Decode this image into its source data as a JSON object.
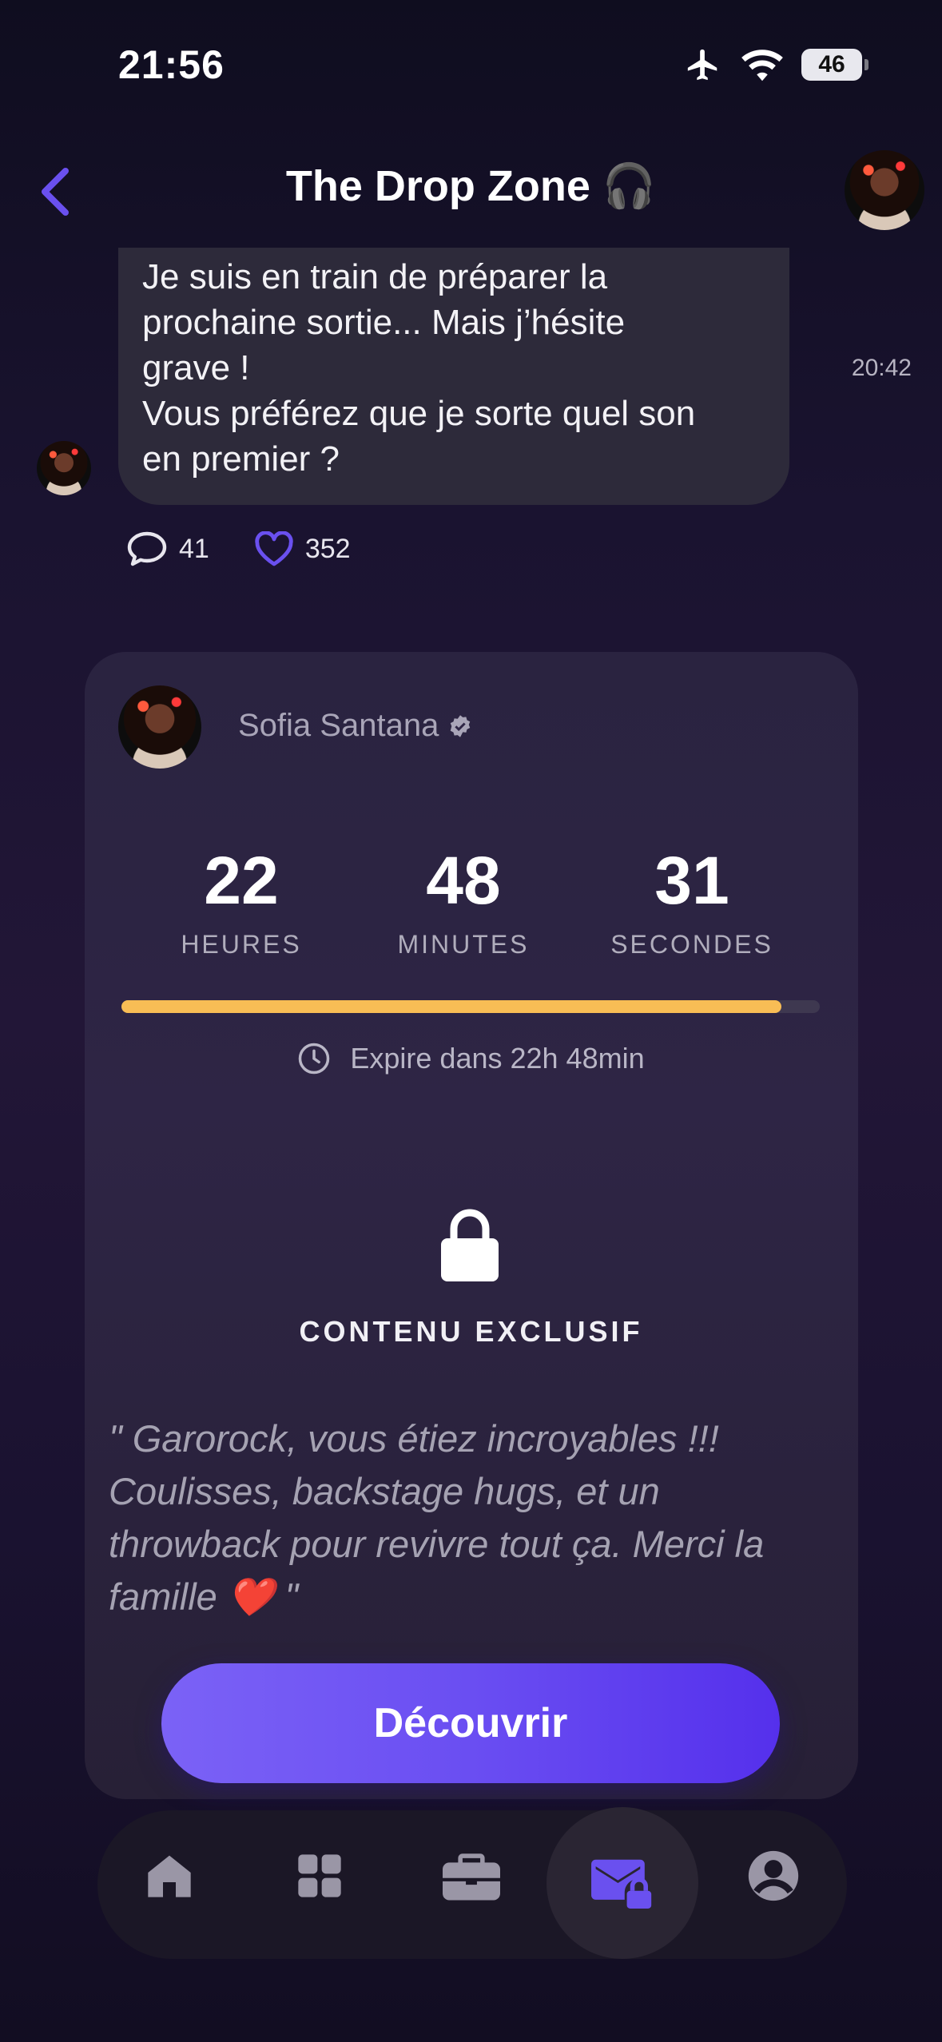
{
  "status_bar": {
    "time": "21:56",
    "battery": "46"
  },
  "header": {
    "title": "The Drop Zone 🎧"
  },
  "message": {
    "lines": [
      "Je suis en train de préparer la",
      "prochaine sortie... Mais j’hésite",
      "grave !",
      "Vous préférez que je sorte quel son",
      "en premier ?"
    ],
    "time": "20:42",
    "comments": "41",
    "likes": "352"
  },
  "card": {
    "artist": "Sofia Santana",
    "countdown": {
      "hours": "22",
      "hours_label": "HEURES",
      "minutes": "48",
      "minutes_label": "MINUTES",
      "seconds": "31",
      "seconds_label": "SECONDES"
    },
    "progress_fraction": 0.945,
    "expire_text": "Expire dans 22h 48min",
    "exclusive_label": "CONTENU EXCLUSIF",
    "quote_lines": [
      "\" Garorock, vous étiez incroyables !!!",
      "Coulisses, backstage hugs, et un",
      "throwback pour revivre tout ça. Merci la",
      "famille ❤️  \""
    ],
    "cta_label": "Découvrir"
  },
  "nav": {
    "items": [
      "home-icon",
      "grid-icon",
      "briefcase-icon",
      "mail-lock-icon",
      "profile-icon"
    ],
    "active": "mail-lock-icon"
  },
  "colors": {
    "accent": "#6a4ef2",
    "progress": "#f8bd55",
    "bubble": "#2d2a3a"
  }
}
